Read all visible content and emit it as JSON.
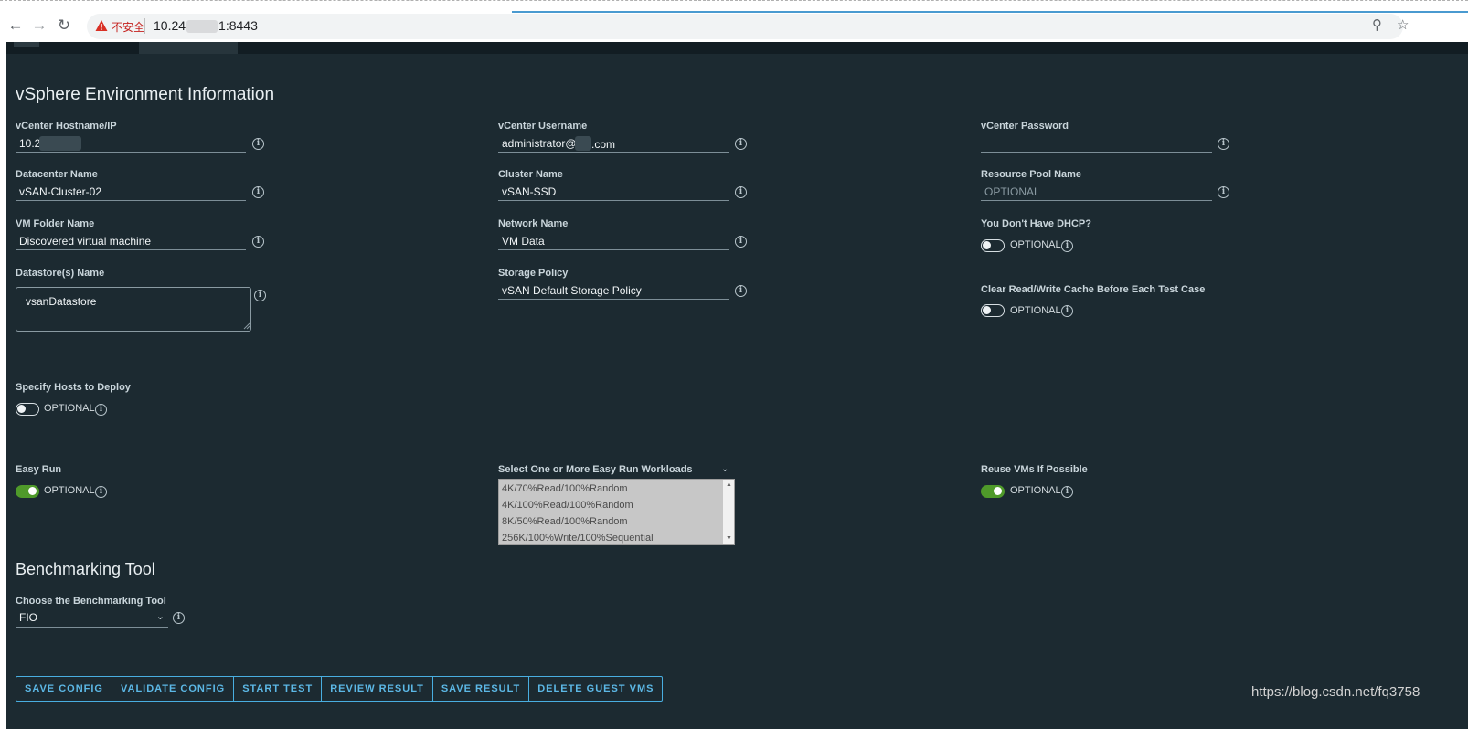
{
  "browser": {
    "insecure_label": "不安全",
    "url_prefix": "10.24",
    "url_suffix": "1:8443"
  },
  "env": {
    "title": "vSphere Environment Information",
    "vcenter_host": {
      "label": "vCenter Hostname/IP",
      "value": "10.2"
    },
    "vcenter_user": {
      "label": "vCenter Username",
      "value": "administrator@",
      "value_tail": ".com"
    },
    "vcenter_password": {
      "label": "vCenter Password",
      "value": ""
    },
    "datacenter": {
      "label": "Datacenter Name",
      "value": "vSAN-Cluster-02"
    },
    "cluster": {
      "label": "Cluster Name",
      "value": "vSAN-SSD"
    },
    "resource_pool": {
      "label": "Resource Pool Name",
      "placeholder": "OPTIONAL"
    },
    "vm_folder": {
      "label": "VM Folder Name",
      "value": "Discovered virtual machine"
    },
    "network": {
      "label": "Network Name",
      "value": "VM Data"
    },
    "no_dhcp": {
      "label": "You Don't Have DHCP?",
      "option": "OPTIONAL",
      "on": false
    },
    "datastore": {
      "label": "Datastore(s) Name",
      "value": "vsanDatastore"
    },
    "storage_policy": {
      "label": "Storage Policy",
      "value": "vSAN Default Storage Policy"
    },
    "clear_cache": {
      "label": "Clear Read/Write Cache Before Each Test Case",
      "option": "OPTIONAL",
      "on": false
    },
    "specify_hosts": {
      "label": "Specify Hosts to Deploy",
      "option": "OPTIONAL",
      "on": false
    },
    "easy_run": {
      "label": "Easy Run",
      "option": "OPTIONAL",
      "on": true
    },
    "workloads": {
      "label": "Select One or More Easy Run Workloads",
      "options": [
        "4K/70%Read/100%Random",
        "4K/100%Read/100%Random",
        "8K/50%Read/100%Random",
        "256K/100%Write/100%Sequential"
      ]
    },
    "reuse_vms": {
      "label": "Reuse VMs If Possible",
      "option": "OPTIONAL",
      "on": true
    }
  },
  "bench": {
    "title": "Benchmarking Tool",
    "tool": {
      "label": "Choose the Benchmarking Tool",
      "value": "FIO"
    }
  },
  "actions": {
    "save_config": "SAVE CONFIG",
    "validate_config": "VALIDATE CONFIG",
    "start_test": "START TEST",
    "review_result": "REVIEW RESULT",
    "save_result": "SAVE RESULT",
    "delete_guest_vms": "DELETE GUEST VMS"
  },
  "watermark_url": "https://blog.csdn.net/fq3758",
  "colors": {
    "background": "#1c2a31",
    "accent": "#49aee0",
    "toggle_on": "#4f9a2a"
  }
}
